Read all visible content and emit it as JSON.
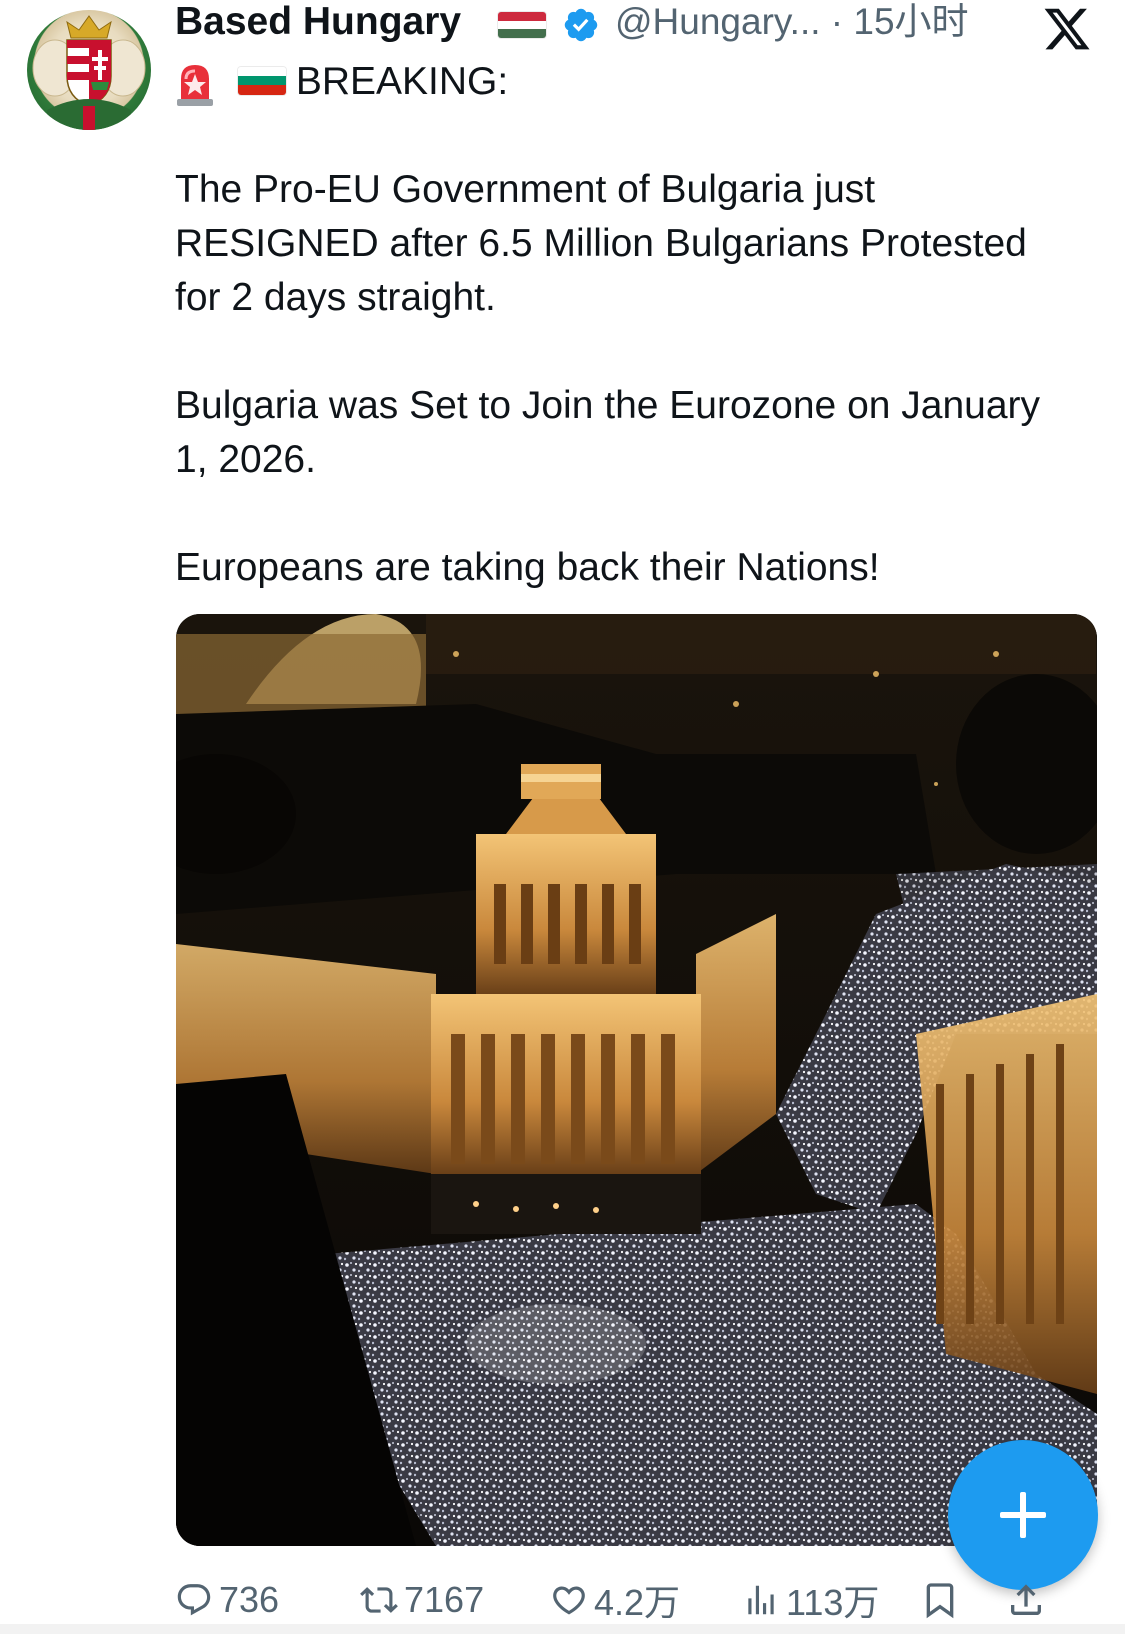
{
  "header": {
    "display_name": "Based Hungary",
    "name_flag_icon": "hungary-flag-icon",
    "verified_icon": "verified-badge-icon",
    "handle_and_time": "@Hungary... · 15小时",
    "app_icon": "x-logo-icon"
  },
  "tweet": {
    "breaking_label": "BREAKING:",
    "paragraphs": [
      "The Pro-EU Government of Bulgaria just RESIGNED after 6.5 Million Bulgarians Protested for 2 days straight.",
      "Bulgaria was Set to Join the Eurozone on January 1, 2026.",
      "Europeans are taking back their Nations!"
    ]
  },
  "actions": {
    "replies": "736",
    "reposts": "7167",
    "likes": "4.2万",
    "views": "113万"
  },
  "colors": {
    "accent": "#1d9bf0",
    "text": "#0f1419",
    "secondary": "#536471"
  },
  "fab": {
    "icon": "plus-icon"
  }
}
